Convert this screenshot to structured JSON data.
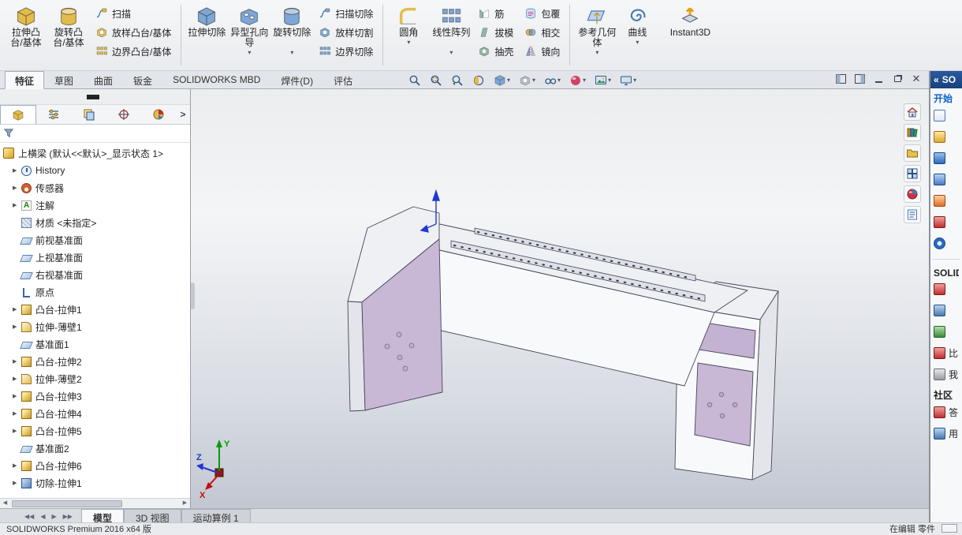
{
  "app": {
    "status_left": "SOLIDWORKS Premium 2016 x64 版",
    "status_right": "在编辑 零件"
  },
  "ribbon": {
    "g0": [
      "拉伸凸台/基体",
      "旋转凸台/基体",
      "扫描",
      "放样凸台/基体",
      "边界凸台/基体"
    ],
    "g1": [
      "拉伸切除",
      "异型孔向导",
      "旋转切除",
      "扫描切除",
      "放样切割",
      "边界切除"
    ],
    "g2": [
      "圆角",
      "线性阵列",
      "筋",
      "拔模",
      "抽壳",
      "包覆",
      "相交",
      "镜向"
    ],
    "g3": [
      "参考几何体",
      "曲线",
      "Instant3D"
    ]
  },
  "tabs": [
    "特征",
    "草图",
    "曲面",
    "钣金",
    "SOLIDWORKS MBD",
    "焊件(D)",
    "评估"
  ],
  "tree": {
    "root": "上横梁 (默认<<默认>_显示状态 1>",
    "items": [
      "History",
      "传感器",
      "注解",
      "材质 <未指定>",
      "前视基准面",
      "上视基准面",
      "右视基准面",
      "原点",
      "凸台-拉伸1",
      "拉伸-薄壁1",
      "基准面1",
      "凸台-拉伸2",
      "拉伸-薄壁2",
      "凸台-拉伸3",
      "凸台-拉伸4",
      "凸台-拉伸5",
      "基准面2",
      "凸台-拉伸6",
      "切除-拉伸1"
    ]
  },
  "viewport": {
    "axis_x": "X",
    "axis_y": "Y",
    "axis_z": "Z"
  },
  "task_pane": {
    "collapse": "«",
    "title": "SO",
    "sections": [
      "开始",
      "SOLID",
      "社区"
    ],
    "fragments": [
      "比",
      "我",
      "答",
      "用"
    ]
  },
  "bottom": {
    "tabs": [
      "模型",
      "3D 视图",
      "运动算例 1"
    ]
  },
  "colors": {
    "purple_face": "#c9b7d6",
    "viewport_top": "#ebedef",
    "viewport_bottom": "#c2c7d1",
    "taskpane_header": "#16417c"
  },
  "icons": {
    "headsup": [
      "zoom-fit",
      "zoom-to-area",
      "previous-view",
      "section-view",
      "view-orientation",
      "display-style",
      "hide-show-items",
      "edit-appearance",
      "apply-scene",
      "view-settings"
    ],
    "panel_tabs": [
      "featuremanager",
      "propertymanager",
      "configurationmanager",
      "dimxpertmanager",
      "displaymanager"
    ],
    "viewport_tabs": [
      "home",
      "design-library",
      "file-explorer",
      "view-palette",
      "appearances",
      "custom-properties"
    ]
  }
}
